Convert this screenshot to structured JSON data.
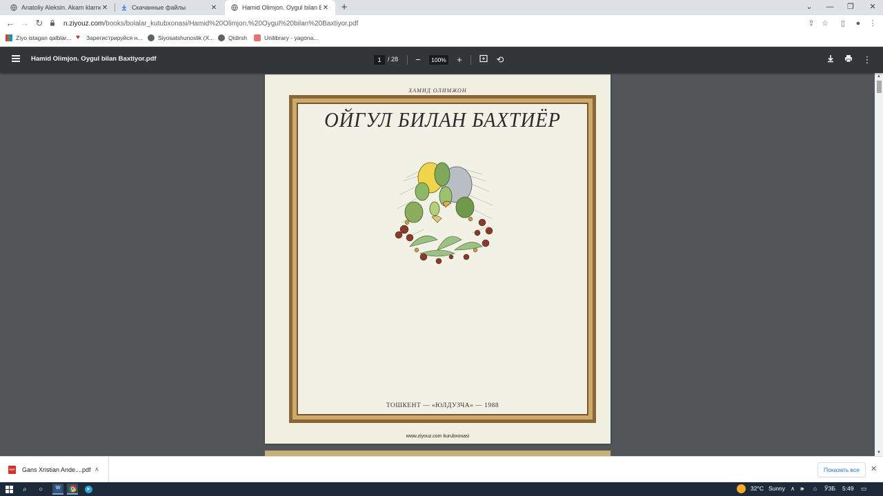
{
  "browser": {
    "tabs": [
      {
        "title": "Anatoliy Aleksin. Akam klarnet ch",
        "active": false,
        "favicon": "globe-icon"
      },
      {
        "title": "Скачанные файлы",
        "active": false,
        "favicon": "download-icon"
      },
      {
        "title": "Hamid Olimjon. Oygul bilan Baxti",
        "active": true,
        "favicon": "globe-icon"
      }
    ],
    "url_host": "n.ziyouz.com",
    "url_path": "/books/bolalar_kutubxonasi/Hamid%20Olimjon.%20Oygul%20bilan%20Baxtiyor.pdf",
    "bookmarks": [
      {
        "label": "Ziyo istagan qalblar...",
        "icon": "bookmark-icon"
      },
      {
        "label": "Зарегистрируйся н...",
        "icon": "heart-icon"
      },
      {
        "label": "Siyosatshunoslik (X...",
        "icon": "globe-icon"
      },
      {
        "label": "Qidirsh",
        "icon": "globe-icon"
      },
      {
        "label": "Unilibrary - yagona...",
        "icon": "book-icon"
      }
    ]
  },
  "pdf": {
    "filename": "Hamid Olimjon. Oygul bilan Baxtiyor.pdf",
    "current_page": "1",
    "total_pages": "/ 28",
    "zoom": "100%",
    "cover": {
      "author": "ХАМИД ОЛИМЖОН",
      "title": "ОЙГУЛ БИЛАН БАХТИЁР",
      "imprint": "ТОШКЕНТ — «ЮЛДУЗЧА» — 1988",
      "footer": "www.ziyouz.com kurubxonasi"
    }
  },
  "downloads": {
    "item": "Gans Xristian Ande....pdf",
    "show_all": "Показать все"
  },
  "taskbar": {
    "weather_temp": "32°C",
    "weather_text": "Sunny",
    "lang": "ЎЗБ",
    "time": "5:49"
  },
  "colors": {
    "pdf_toolbar": "#323639",
    "viewer_bg": "#525659",
    "frame_brown": "#8a6638",
    "frame_gold": "#cda96a",
    "taskbar": "#1c2a3a"
  }
}
